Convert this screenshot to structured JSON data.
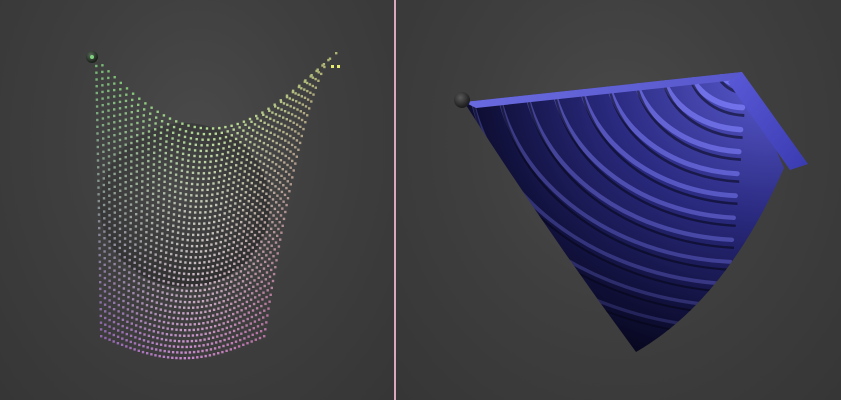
{
  "viewports": {
    "left": {
      "name": "particle-cloth-viewport",
      "cloth_colors": {
        "top_left": "#8fe68a",
        "top_right": "#d9e08a",
        "bottom_left": "#b07ad6",
        "bottom_right": "#e08ac8",
        "center": "#cfcfcf"
      },
      "sphere_color": "#3b3b3b",
      "handle_color": "#2a3a2a"
    },
    "right": {
      "name": "shaded-sheet-viewport",
      "surface_color": "#4a4ac8",
      "surface_dark": "#08081a",
      "handle_color": "#3a3a3a"
    }
  },
  "divider": {
    "color": "#e8c0d0"
  }
}
